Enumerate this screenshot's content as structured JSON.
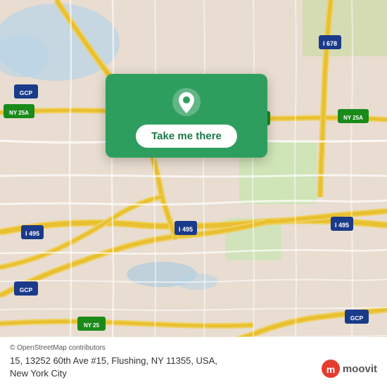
{
  "map": {
    "bg_color": "#e8e0d5",
    "center_lat": 40.74,
    "center_lng": -73.83
  },
  "card": {
    "button_label": "Take me there",
    "bg_color": "#2e9e5e"
  },
  "bottom_bar": {
    "attribution": "© OpenStreetMap contributors",
    "address_line1": "15, 13252 60th Ave #15, Flushing, NY 11355, USA,",
    "address_line2": "New York City"
  },
  "moovit": {
    "logo_text": "moovit"
  }
}
